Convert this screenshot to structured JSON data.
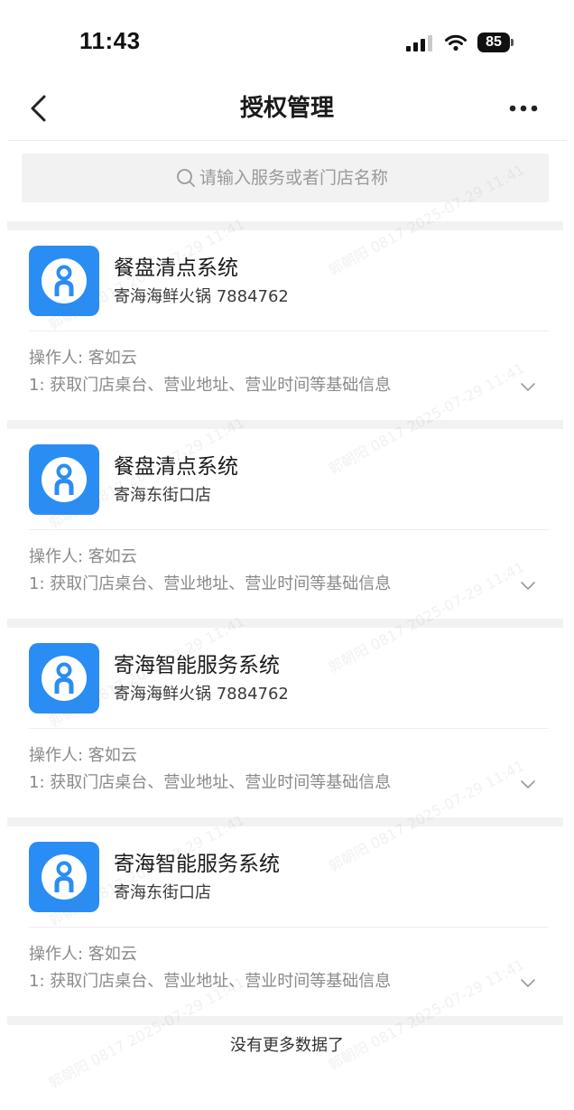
{
  "status_bar": {
    "time": "11:43",
    "battery_level": "85",
    "icons": {
      "signal": "cellular-signal-icon",
      "wifi": "wifi-icon",
      "battery": "battery-icon"
    }
  },
  "nav": {
    "title": "授权管理",
    "back_icon": "chevron-left-icon",
    "more_icon": "more-dots-icon"
  },
  "search": {
    "placeholder": "请输入服务或者门店名称",
    "icon": "search-icon"
  },
  "cards": [
    {
      "service_name": "餐盘清点系统",
      "store": "寄海海鲜火锅 7884762",
      "operator": "操作人: 客如云",
      "permission": "1: 获取门店桌台、营业地址、营业时间等基础信息",
      "logo_icon": "keruyun-logo-icon",
      "expand_icon": "chevron-down-icon"
    },
    {
      "service_name": "餐盘清点系统",
      "store": "寄海东街口店",
      "operator": "操作人: 客如云",
      "permission": "1: 获取门店桌台、营业地址、营业时间等基础信息",
      "logo_icon": "keruyun-logo-icon",
      "expand_icon": "chevron-down-icon"
    },
    {
      "service_name": "寄海智能服务系统",
      "store": "寄海海鲜火锅 7884762",
      "operator": "操作人: 客如云",
      "permission": "1: 获取门店桌台、营业地址、营业时间等基础信息",
      "logo_icon": "keruyun-logo-icon",
      "expand_icon": "chevron-down-icon"
    },
    {
      "service_name": "寄海智能服务系统",
      "store": "寄海东街口店",
      "operator": "操作人: 客如云",
      "permission": "1: 获取门店桌台、营业地址、营业时间等基础信息",
      "logo_icon": "keruyun-logo-icon",
      "expand_icon": "chevron-down-icon"
    }
  ],
  "footer": {
    "end_text": "没有更多数据了"
  },
  "watermark": "郭朝阳 0817 2025-07-29 11:41",
  "colors": {
    "logo_blue": "#2a8df4",
    "separator_gray": "#f2f2f2",
    "secondary_text": "#8a8a8a"
  }
}
